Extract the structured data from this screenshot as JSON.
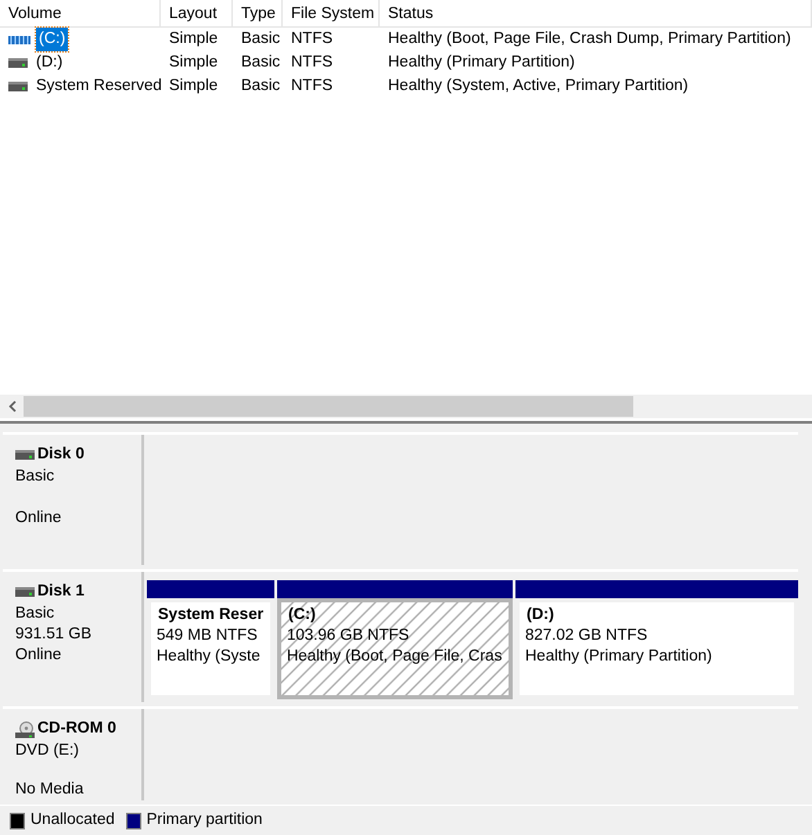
{
  "volume_list": {
    "columns": [
      "Volume",
      "Layout",
      "Type",
      "File System",
      "Status"
    ],
    "rows": [
      {
        "kind": "system",
        "selected": true,
        "cells": [
          "(C:)",
          "Simple",
          "Basic",
          "NTFS",
          "Healthy (Boot, Page File, Crash Dump, Primary Partition)"
        ]
      },
      {
        "kind": "drive",
        "selected": false,
        "cells": [
          "(D:)",
          "Simple",
          "Basic",
          "NTFS",
          "Healthy (Primary Partition)"
        ]
      },
      {
        "kind": "drive",
        "selected": false,
        "cells": [
          "System Reserved",
          "Simple",
          "Basic",
          "NTFS",
          "Healthy (System, Active, Primary Partition)"
        ]
      }
    ]
  },
  "disks": [
    {
      "kind": "disk",
      "name": "Disk 0",
      "type": "Basic",
      "status": "Online"
    },
    {
      "kind": "disk",
      "name": "Disk 1",
      "type": "Basic",
      "size": "931.51 GB",
      "status": "Online",
      "partitions": [
        {
          "name": "System Reser",
          "size": "549 MB NTFS",
          "status": "Healthy (Syste",
          "selected": false
        },
        {
          "name": "(C:)",
          "size": "103.96 GB NTFS",
          "status": "Healthy (Boot, Page File, Cras",
          "selected": true
        },
        {
          "name": "(D:)",
          "size": "827.02 GB NTFS",
          "status": "Healthy (Primary Partition)",
          "selected": false
        }
      ]
    },
    {
      "kind": "cdrom",
      "name": "CD-ROM 0",
      "type": "DVD (E:)",
      "status": "No Media"
    }
  ],
  "legend": [
    {
      "label": "Unallocated",
      "color": "#000000"
    },
    {
      "label": "Primary partition",
      "color": "#000080"
    }
  ]
}
